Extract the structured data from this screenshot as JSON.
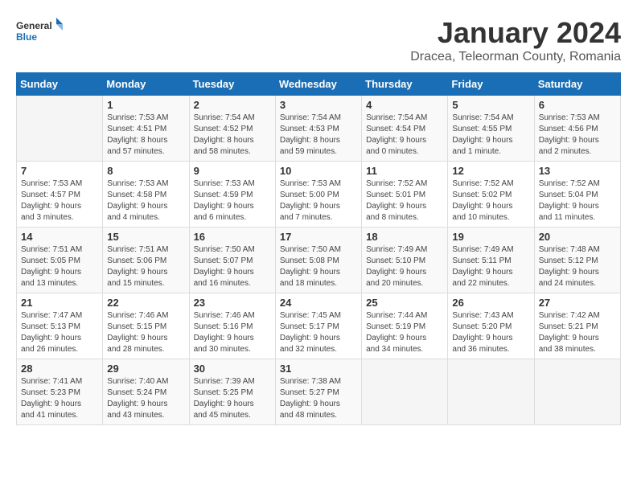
{
  "logo": {
    "general": "General",
    "blue": "Blue"
  },
  "header": {
    "title": "January 2024",
    "subtitle": "Dracea, Teleorman County, Romania"
  },
  "weekdays": [
    "Sunday",
    "Monday",
    "Tuesday",
    "Wednesday",
    "Thursday",
    "Friday",
    "Saturday"
  ],
  "weeks": [
    [
      {
        "day": "",
        "info": ""
      },
      {
        "day": "1",
        "info": "Sunrise: 7:53 AM\nSunset: 4:51 PM\nDaylight: 8 hours\nand 57 minutes."
      },
      {
        "day": "2",
        "info": "Sunrise: 7:54 AM\nSunset: 4:52 PM\nDaylight: 8 hours\nand 58 minutes."
      },
      {
        "day": "3",
        "info": "Sunrise: 7:54 AM\nSunset: 4:53 PM\nDaylight: 8 hours\nand 59 minutes."
      },
      {
        "day": "4",
        "info": "Sunrise: 7:54 AM\nSunset: 4:54 PM\nDaylight: 9 hours\nand 0 minutes."
      },
      {
        "day": "5",
        "info": "Sunrise: 7:54 AM\nSunset: 4:55 PM\nDaylight: 9 hours\nand 1 minute."
      },
      {
        "day": "6",
        "info": "Sunrise: 7:53 AM\nSunset: 4:56 PM\nDaylight: 9 hours\nand 2 minutes."
      }
    ],
    [
      {
        "day": "7",
        "info": "Sunrise: 7:53 AM\nSunset: 4:57 PM\nDaylight: 9 hours\nand 3 minutes."
      },
      {
        "day": "8",
        "info": "Sunrise: 7:53 AM\nSunset: 4:58 PM\nDaylight: 9 hours\nand 4 minutes."
      },
      {
        "day": "9",
        "info": "Sunrise: 7:53 AM\nSunset: 4:59 PM\nDaylight: 9 hours\nand 6 minutes."
      },
      {
        "day": "10",
        "info": "Sunrise: 7:53 AM\nSunset: 5:00 PM\nDaylight: 9 hours\nand 7 minutes."
      },
      {
        "day": "11",
        "info": "Sunrise: 7:52 AM\nSunset: 5:01 PM\nDaylight: 9 hours\nand 8 minutes."
      },
      {
        "day": "12",
        "info": "Sunrise: 7:52 AM\nSunset: 5:02 PM\nDaylight: 9 hours\nand 10 minutes."
      },
      {
        "day": "13",
        "info": "Sunrise: 7:52 AM\nSunset: 5:04 PM\nDaylight: 9 hours\nand 11 minutes."
      }
    ],
    [
      {
        "day": "14",
        "info": "Sunrise: 7:51 AM\nSunset: 5:05 PM\nDaylight: 9 hours\nand 13 minutes."
      },
      {
        "day": "15",
        "info": "Sunrise: 7:51 AM\nSunset: 5:06 PM\nDaylight: 9 hours\nand 15 minutes."
      },
      {
        "day": "16",
        "info": "Sunrise: 7:50 AM\nSunset: 5:07 PM\nDaylight: 9 hours\nand 16 minutes."
      },
      {
        "day": "17",
        "info": "Sunrise: 7:50 AM\nSunset: 5:08 PM\nDaylight: 9 hours\nand 18 minutes."
      },
      {
        "day": "18",
        "info": "Sunrise: 7:49 AM\nSunset: 5:10 PM\nDaylight: 9 hours\nand 20 minutes."
      },
      {
        "day": "19",
        "info": "Sunrise: 7:49 AM\nSunset: 5:11 PM\nDaylight: 9 hours\nand 22 minutes."
      },
      {
        "day": "20",
        "info": "Sunrise: 7:48 AM\nSunset: 5:12 PM\nDaylight: 9 hours\nand 24 minutes."
      }
    ],
    [
      {
        "day": "21",
        "info": "Sunrise: 7:47 AM\nSunset: 5:13 PM\nDaylight: 9 hours\nand 26 minutes."
      },
      {
        "day": "22",
        "info": "Sunrise: 7:46 AM\nSunset: 5:15 PM\nDaylight: 9 hours\nand 28 minutes."
      },
      {
        "day": "23",
        "info": "Sunrise: 7:46 AM\nSunset: 5:16 PM\nDaylight: 9 hours\nand 30 minutes."
      },
      {
        "day": "24",
        "info": "Sunrise: 7:45 AM\nSunset: 5:17 PM\nDaylight: 9 hours\nand 32 minutes."
      },
      {
        "day": "25",
        "info": "Sunrise: 7:44 AM\nSunset: 5:19 PM\nDaylight: 9 hours\nand 34 minutes."
      },
      {
        "day": "26",
        "info": "Sunrise: 7:43 AM\nSunset: 5:20 PM\nDaylight: 9 hours\nand 36 minutes."
      },
      {
        "day": "27",
        "info": "Sunrise: 7:42 AM\nSunset: 5:21 PM\nDaylight: 9 hours\nand 38 minutes."
      }
    ],
    [
      {
        "day": "28",
        "info": "Sunrise: 7:41 AM\nSunset: 5:23 PM\nDaylight: 9 hours\nand 41 minutes."
      },
      {
        "day": "29",
        "info": "Sunrise: 7:40 AM\nSunset: 5:24 PM\nDaylight: 9 hours\nand 43 minutes."
      },
      {
        "day": "30",
        "info": "Sunrise: 7:39 AM\nSunset: 5:25 PM\nDaylight: 9 hours\nand 45 minutes."
      },
      {
        "day": "31",
        "info": "Sunrise: 7:38 AM\nSunset: 5:27 PM\nDaylight: 9 hours\nand 48 minutes."
      },
      {
        "day": "",
        "info": ""
      },
      {
        "day": "",
        "info": ""
      },
      {
        "day": "",
        "info": ""
      }
    ]
  ]
}
